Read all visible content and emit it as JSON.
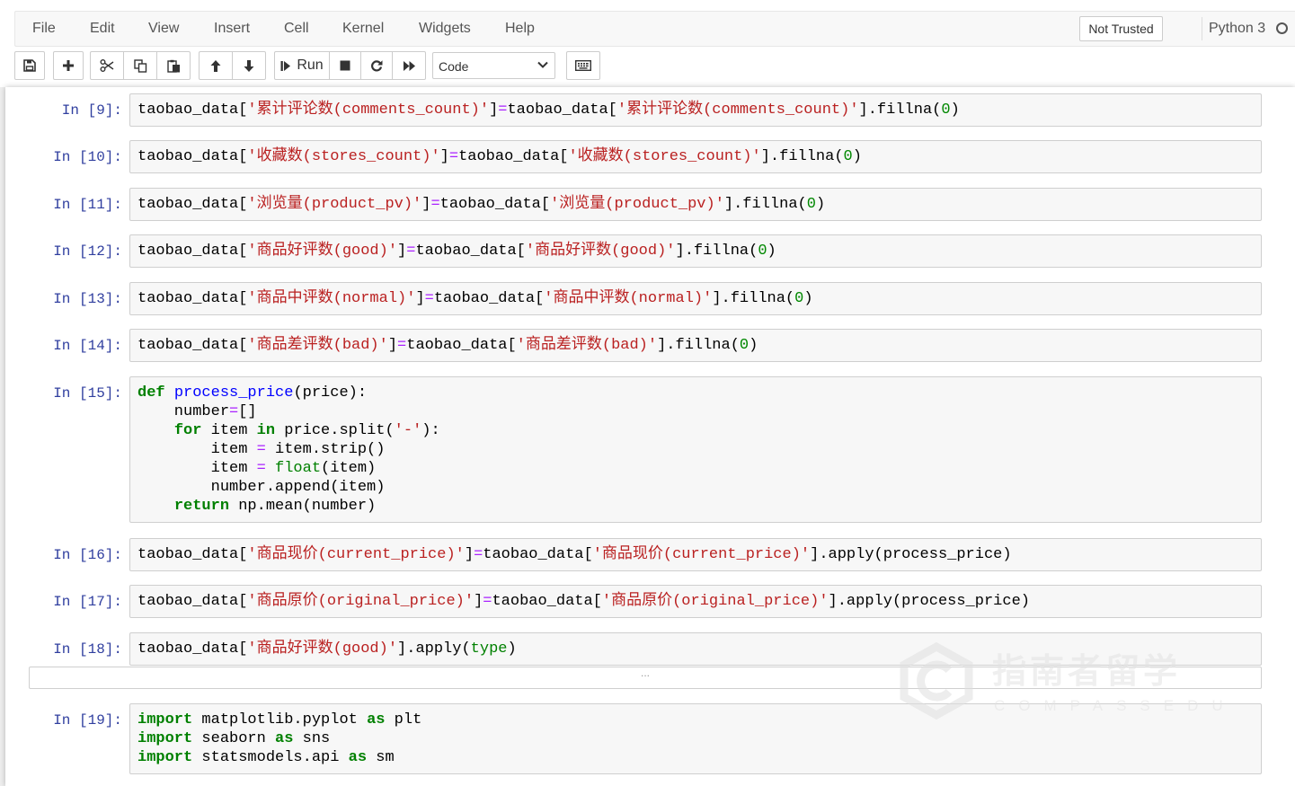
{
  "menu": {
    "items": [
      "File",
      "Edit",
      "View",
      "Insert",
      "Cell",
      "Kernel",
      "Widgets",
      "Help"
    ],
    "trusted_label": "Not Trusted",
    "kernel_name": "Python 3"
  },
  "toolbar": {
    "icons": {
      "save": "floppy-disk-icon",
      "insert": "plus-icon",
      "cut": "scissors-icon",
      "copy": "copy-icon",
      "paste": "clipboard-icon",
      "move_up": "arrow-up-icon",
      "move_down": "arrow-down-icon",
      "run": "step-forward-icon",
      "interrupt": "stop-square-icon",
      "restart": "redo-icon",
      "restart_run_all": "fast-forward-icon",
      "command_palette": "keyboard-icon"
    },
    "run_label": "Run",
    "cell_type": "Code"
  },
  "cells": [
    {
      "prompt": "In [9]:",
      "lines": [
        [
          [
            "taobao_data[",
            ""
          ],
          [
            "'累计评论数(comments_count)'",
            "s"
          ],
          [
            "]",
            ""
          ],
          [
            "=",
            "o"
          ],
          [
            "taobao_data[",
            ""
          ],
          [
            "'累计评论数(comments_count)'",
            "s"
          ],
          [
            "].fillna(",
            ""
          ],
          [
            "0",
            "n"
          ],
          [
            ")",
            ""
          ]
        ]
      ]
    },
    {
      "prompt": "In [10]:",
      "lines": [
        [
          [
            "taobao_data[",
            ""
          ],
          [
            "'收藏数(stores_count)'",
            "s"
          ],
          [
            "]",
            ""
          ],
          [
            "=",
            "o"
          ],
          [
            "taobao_data[",
            ""
          ],
          [
            "'收藏数(stores_count)'",
            "s"
          ],
          [
            "].fillna(",
            ""
          ],
          [
            "0",
            "n"
          ],
          [
            ")",
            ""
          ]
        ]
      ]
    },
    {
      "prompt": "In [11]:",
      "lines": [
        [
          [
            "taobao_data[",
            ""
          ],
          [
            "'浏览量(product_pv)'",
            "s"
          ],
          [
            "]",
            ""
          ],
          [
            "=",
            "o"
          ],
          [
            "taobao_data[",
            ""
          ],
          [
            "'浏览量(product_pv)'",
            "s"
          ],
          [
            "].fillna(",
            ""
          ],
          [
            "0",
            "n"
          ],
          [
            ")",
            ""
          ]
        ]
      ]
    },
    {
      "prompt": "In [12]:",
      "lines": [
        [
          [
            "taobao_data[",
            ""
          ],
          [
            "'商品好评数(good)'",
            "s"
          ],
          [
            "]",
            ""
          ],
          [
            "=",
            "o"
          ],
          [
            "taobao_data[",
            ""
          ],
          [
            "'商品好评数(good)'",
            "s"
          ],
          [
            "].fillna(",
            ""
          ],
          [
            "0",
            "n"
          ],
          [
            ")",
            ""
          ]
        ]
      ]
    },
    {
      "prompt": "In [13]:",
      "lines": [
        [
          [
            "taobao_data[",
            ""
          ],
          [
            "'商品中评数(normal)'",
            "s"
          ],
          [
            "]",
            ""
          ],
          [
            "=",
            "o"
          ],
          [
            "taobao_data[",
            ""
          ],
          [
            "'商品中评数(normal)'",
            "s"
          ],
          [
            "].fillna(",
            ""
          ],
          [
            "0",
            "n"
          ],
          [
            ")",
            ""
          ]
        ]
      ]
    },
    {
      "prompt": "In [14]:",
      "lines": [
        [
          [
            "taobao_data[",
            ""
          ],
          [
            "'商品差评数(bad)'",
            "s"
          ],
          [
            "]",
            ""
          ],
          [
            "=",
            "o"
          ],
          [
            "taobao_data[",
            ""
          ],
          [
            "'商品差评数(bad)'",
            "s"
          ],
          [
            "].fillna(",
            ""
          ],
          [
            "0",
            "n"
          ],
          [
            ")",
            ""
          ]
        ]
      ]
    },
    {
      "prompt": "In [15]:",
      "lines": [
        [
          [
            "def",
            "k"
          ],
          [
            " ",
            ""
          ],
          [
            "process_price",
            "f"
          ],
          [
            "(price):",
            ""
          ]
        ],
        [
          [
            "    number",
            ""
          ],
          [
            "=",
            "o"
          ],
          [
            "[]",
            ""
          ]
        ],
        [
          [
            "    ",
            ""
          ],
          [
            "for",
            "k"
          ],
          [
            " item ",
            ""
          ],
          [
            "in",
            "k"
          ],
          [
            " price.split(",
            ""
          ],
          [
            "'-'",
            "s"
          ],
          [
            "):",
            ""
          ]
        ],
        [
          [
            "        item ",
            ""
          ],
          [
            "=",
            "o"
          ],
          [
            " item.strip()",
            ""
          ]
        ],
        [
          [
            "        item ",
            ""
          ],
          [
            "=",
            "o"
          ],
          [
            " ",
            ""
          ],
          [
            "float",
            "b"
          ],
          [
            "(item)",
            ""
          ]
        ],
        [
          [
            "        number.append(item)",
            ""
          ]
        ],
        [
          [
            "    ",
            ""
          ],
          [
            "return",
            "k"
          ],
          [
            " np.mean(number)",
            ""
          ]
        ]
      ]
    },
    {
      "prompt": "In [16]:",
      "lines": [
        [
          [
            "taobao_data[",
            ""
          ],
          [
            "'商品现价(current_price)'",
            "s"
          ],
          [
            "]",
            ""
          ],
          [
            "=",
            "o"
          ],
          [
            "taobao_data[",
            ""
          ],
          [
            "'商品现价(current_price)'",
            "s"
          ],
          [
            "].apply(process_price)",
            ""
          ]
        ]
      ]
    },
    {
      "prompt": "In [17]:",
      "lines": [
        [
          [
            "taobao_data[",
            ""
          ],
          [
            "'商品原价(original_price)'",
            "s"
          ],
          [
            "]",
            ""
          ],
          [
            "=",
            "o"
          ],
          [
            "taobao_data[",
            ""
          ],
          [
            "'商品原价(original_price)'",
            "s"
          ],
          [
            "].apply(process_price)",
            ""
          ]
        ]
      ]
    },
    {
      "prompt": "In [18]:",
      "lines": [
        [
          [
            "taobao_data[",
            ""
          ],
          [
            "'商品好评数(good)'",
            "s"
          ],
          [
            "].apply(",
            ""
          ],
          [
            "type",
            "b"
          ],
          [
            ")",
            ""
          ]
        ]
      ]
    },
    {
      "prompt": "In [19]:",
      "lines": [
        [
          [
            "import",
            "k"
          ],
          [
            " matplotlib.pyplot ",
            ""
          ],
          [
            "as",
            "k"
          ],
          [
            " plt",
            ""
          ]
        ],
        [
          [
            "import",
            "k"
          ],
          [
            " seaborn ",
            ""
          ],
          [
            "as",
            "k"
          ],
          [
            " sns",
            ""
          ]
        ],
        [
          [
            "import",
            "k"
          ],
          [
            " statsmodels.api ",
            ""
          ],
          [
            "as",
            "k"
          ],
          [
            " sm",
            ""
          ]
        ]
      ]
    }
  ],
  "collapsed_output": "...",
  "watermark": {
    "logo_icon": "compass-logo-icon",
    "text_cn": "指南者留学",
    "text_en": "COMPASSEDU"
  }
}
